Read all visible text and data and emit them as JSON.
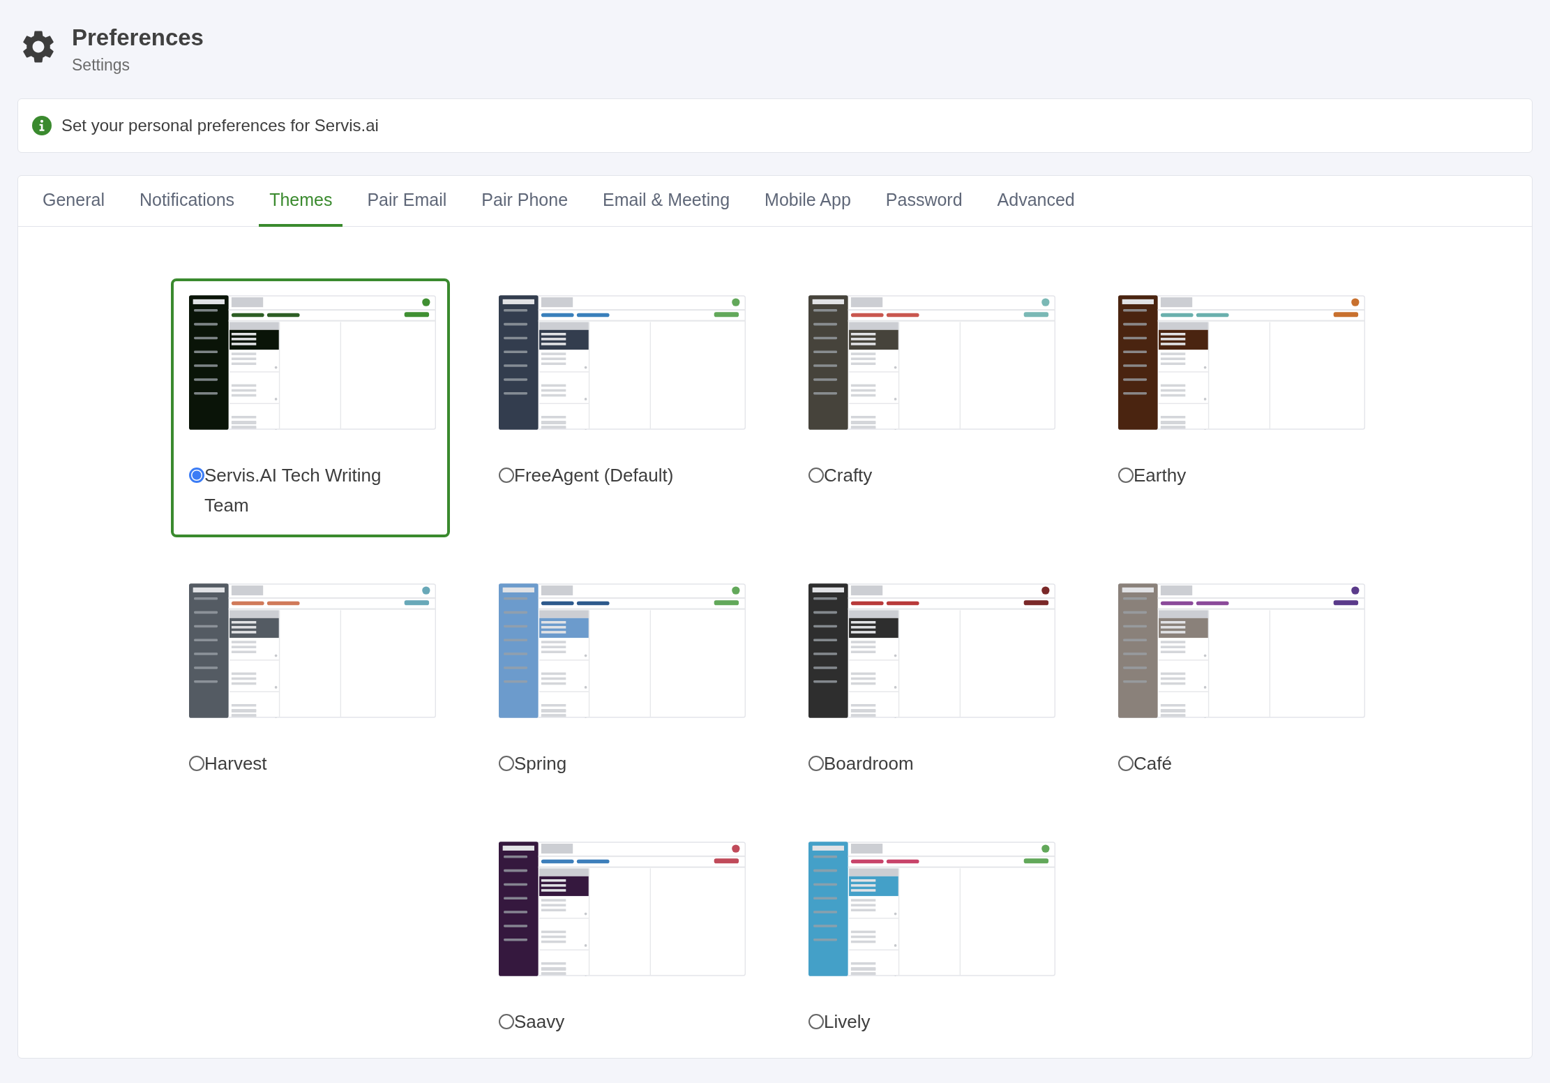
{
  "header": {
    "title": "Preferences",
    "subtitle": "Settings"
  },
  "info": {
    "text": "Set your personal preferences for Servis.ai"
  },
  "tabs": [
    {
      "label": "General",
      "selected": false
    },
    {
      "label": "Notifications",
      "selected": false
    },
    {
      "label": "Themes",
      "selected": true
    },
    {
      "label": "Pair Email",
      "selected": false
    },
    {
      "label": "Pair Phone",
      "selected": false
    },
    {
      "label": "Email & Meeting",
      "selected": false
    },
    {
      "label": "Mobile App",
      "selected": false
    },
    {
      "label": "Password",
      "selected": false
    },
    {
      "label": "Advanced",
      "selected": false
    }
  ],
  "themes": [
    {
      "name": "Servis.AI Tech Writing Team",
      "selected": true,
      "colors": [
        {
          "color": "#0a1408"
        },
        {
          "color": "#2d5e25"
        },
        {
          "color": "#3f8f32"
        }
      ]
    },
    {
      "name": "FreeAgent (Default)",
      "selected": false,
      "colors": [
        {
          "color": "#333d4e"
        },
        {
          "color": "#3a80bb"
        },
        {
          "color": "#62a85a"
        }
      ]
    },
    {
      "name": "Crafty",
      "selected": false,
      "colors": [
        {
          "color": "#46433b"
        },
        {
          "color": "#c9574f"
        },
        {
          "color": "#7ab8b5"
        }
      ]
    },
    {
      "name": "Earthy",
      "selected": false,
      "colors": [
        {
          "color": "#4a2410"
        },
        {
          "color": "#6ab0ad"
        },
        {
          "color": "#c8702e"
        }
      ]
    },
    {
      "name": "Harvest",
      "selected": false,
      "colors": [
        {
          "color": "#545b63"
        },
        {
          "color": "#d07a5a"
        },
        {
          "color": "#68a8b8"
        }
      ]
    },
    {
      "name": "Spring",
      "selected": false,
      "colors": [
        {
          "color": "#6c9bcc"
        },
        {
          "color": "#2e5a8c"
        },
        {
          "color": "#62a85a"
        }
      ]
    },
    {
      "name": "Boardroom",
      "selected": false,
      "colors": [
        {
          "color": "#2e2e2e"
        },
        {
          "color": "#b83a3a"
        },
        {
          "color": "#7a2828"
        }
      ]
    },
    {
      "name": "Café",
      "selected": false,
      "colors": [
        {
          "color": "#8a817a"
        },
        {
          "color": "#8b4a9a"
        },
        {
          "color": "#5a3a8a"
        }
      ]
    },
    {
      "name": "Saavy",
      "selected": false,
      "colors": [
        {
          "color": "#35183e"
        },
        {
          "color": "#3d7fbb"
        },
        {
          "color": "#c04a5a"
        }
      ]
    },
    {
      "name": "Lively",
      "selected": false,
      "colors": [
        {
          "color": "#44a0c8"
        },
        {
          "color": "#c8446a"
        },
        {
          "color": "#62a85a"
        }
      ]
    }
  ]
}
